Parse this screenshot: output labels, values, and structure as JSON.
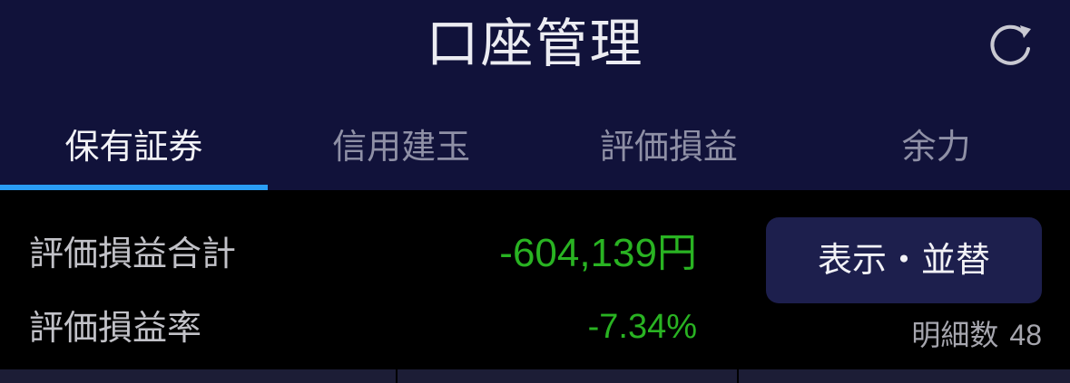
{
  "header": {
    "title": "口座管理",
    "refresh_icon": "refresh-icon"
  },
  "tabs": [
    {
      "label": "保有証券",
      "active": true
    },
    {
      "label": "信用建玉",
      "active": false
    },
    {
      "label": "評価損益",
      "active": false
    },
    {
      "label": "余力",
      "active": false
    }
  ],
  "summary": {
    "total_label": "評価損益合計",
    "total_value": "-604,139円",
    "rate_label": "評価損益率",
    "rate_value": "-7.34%",
    "display_sort_button": "表示・並替",
    "detail_count_label": "明細数",
    "detail_count": "48"
  },
  "colors": {
    "header_bg": "#11123a",
    "tab_indicator": "#2a9df4",
    "negative_value": "#29b322",
    "button_bg": "#1d1f4d"
  }
}
